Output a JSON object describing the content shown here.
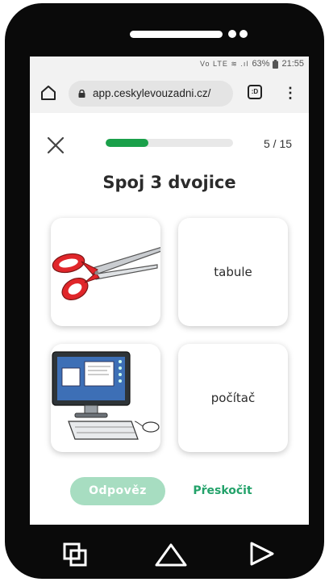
{
  "statusbar": {
    "icons": "Vo LTE ≋ .ıl",
    "battery": "63%",
    "time": "21:55"
  },
  "browser": {
    "url": "app.ceskylevouzadni.cz/",
    "tabs_count": ":D"
  },
  "exercise": {
    "title": "Spoj 3 dvojice",
    "progress_text": "5 / 15",
    "progress_fraction": 0.333
  },
  "cards": [
    {
      "type": "image",
      "icon": "scissors-icon"
    },
    {
      "type": "text",
      "label": "tabule"
    },
    {
      "type": "image",
      "icon": "computer-icon"
    },
    {
      "type": "text",
      "label": "počítač"
    }
  ],
  "actions": {
    "answer_label": "Odpověz",
    "skip_label": "Přeskočit"
  },
  "colors": {
    "progress": "#1aa04a",
    "answer_button": "#a7ddc1",
    "skip_text": "#23a26a"
  }
}
